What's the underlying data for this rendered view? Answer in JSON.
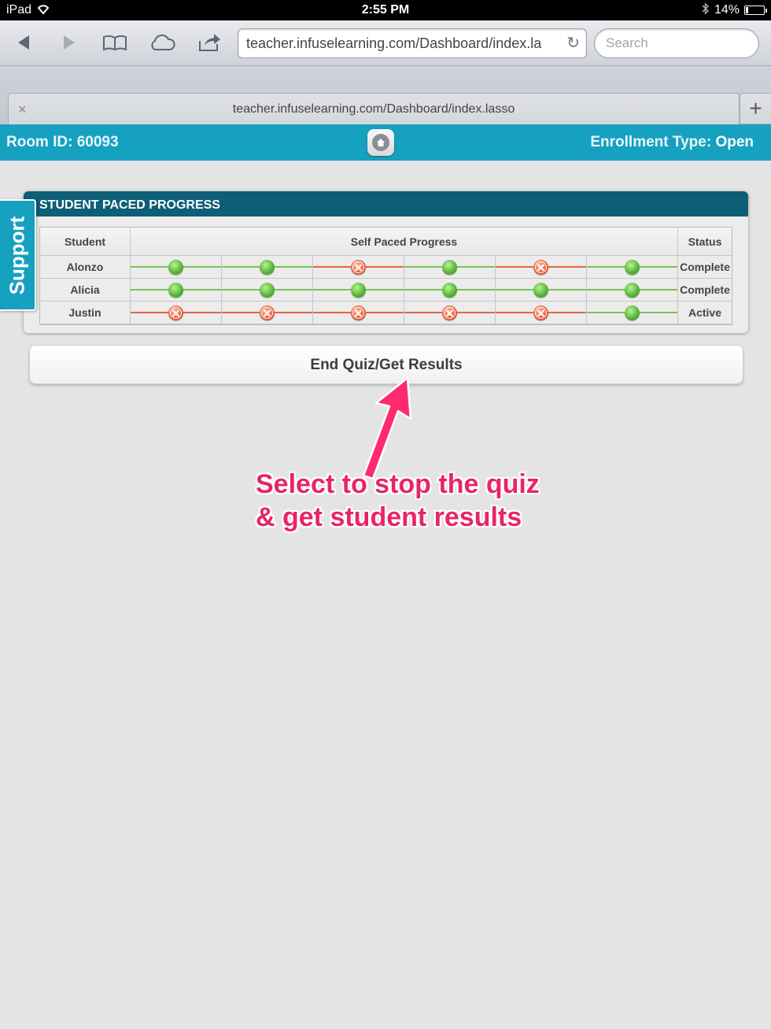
{
  "status_bar": {
    "device": "iPad",
    "time": "2:55 PM",
    "battery": "14%"
  },
  "browser": {
    "url": "teacher.infuselearning.com/Dashboard/index.la",
    "search_placeholder": "Search",
    "tab_title": "teacher.infuselearning.com/Dashboard/index.lasso",
    "tab_close": "×",
    "new_tab": "+"
  },
  "header": {
    "room_id": "Room ID: 60093",
    "enrollment_label": "Enrollment Type: ",
    "enrollment_value": "Open"
  },
  "support_label": "Support",
  "panel": {
    "title": "STUDENT PACED PROGRESS",
    "columns": {
      "student": "Student",
      "progress": "Self Paced Progress",
      "status": "Status"
    },
    "rows": [
      {
        "student": "Alonzo",
        "status": "Complete",
        "steps": [
          "ok",
          "ok",
          "bad",
          "ok",
          "bad",
          "ok"
        ]
      },
      {
        "student": "Alicia",
        "status": "Complete",
        "steps": [
          "ok",
          "ok",
          "ok",
          "ok",
          "ok",
          "ok"
        ]
      },
      {
        "student": "Justin",
        "status": "Active",
        "steps": [
          "bad",
          "bad",
          "bad",
          "bad",
          "bad",
          "ok"
        ]
      }
    ]
  },
  "end_button": "End Quiz/Get Results",
  "annotation": {
    "line1": "Select to stop the quiz",
    "line2": "& get student results",
    "color": "#e8246a"
  },
  "colors": {
    "header": "#16a1c0",
    "panel_header": "#0d5e77",
    "ok": "#52b233",
    "bad": "#e85a34"
  }
}
